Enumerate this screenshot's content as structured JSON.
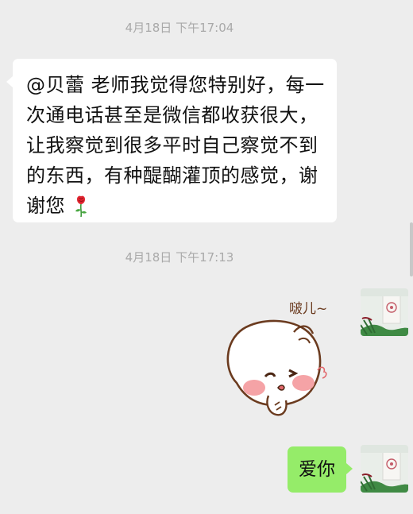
{
  "messages": [
    {
      "timestamp": "4月18日 下午17:04",
      "sender": "other",
      "text": "@贝蕾  老师我觉得您特别好，每一次通电话甚至是微信都收获很大，让我察觉到很多平时自己察觉不到的东西，有种醍醐灌顶的感觉，谢谢您",
      "emoji": "rose-icon"
    },
    {
      "timestamp": "4月18日 下午17:13",
      "sender": "self",
      "sticker": {
        "caption": "啵儿~",
        "icon": "cute-bun-kiss-sticker"
      }
    },
    {
      "sender": "self",
      "text": "爱你"
    }
  ],
  "colors": {
    "background": "#ededed",
    "incoming_bubble": "#ffffff",
    "outgoing_bubble": "#95ec69",
    "timestamp_text": "#a9a9a9"
  }
}
